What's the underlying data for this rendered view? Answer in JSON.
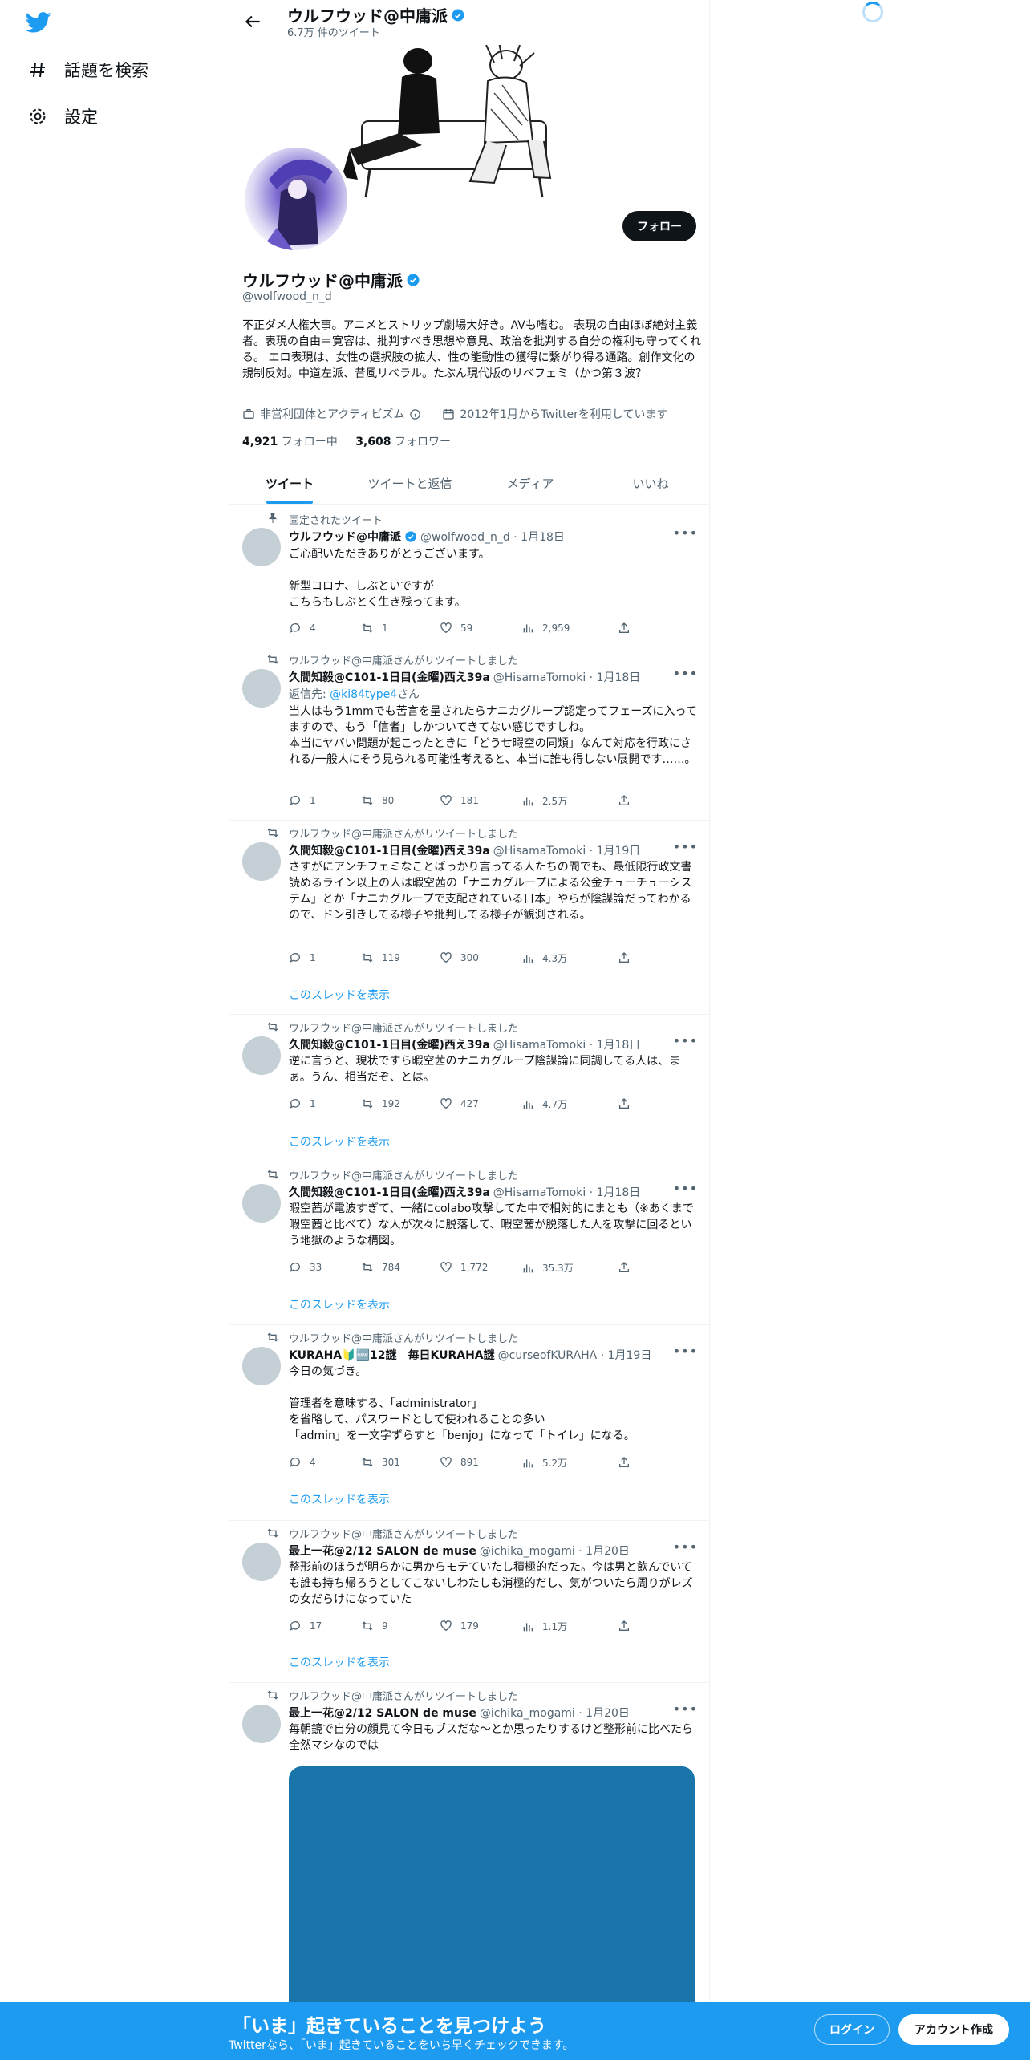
{
  "nav": {
    "explore_label": "話題を検索",
    "settings_label": "設定"
  },
  "header": {
    "name": "ウルフウッド@中庸派",
    "tweet_count": "6.7万 件のツイート"
  },
  "profile": {
    "follow_label": "フォロー",
    "name": "ウルフウッド@中庸派",
    "handle": "@wolfwood_n_d",
    "bio": "不正ダメ人権大事。アニメとストリップ劇場大好き。AVも嗜む。 表現の自由ほぼ絶対主義者。表現の自由＝寛容は、批判すべき思想や意見、政治を批判する自分の権利も守ってくれる。 エロ表現は、女性の選択肢の拡大、性の能動性の獲得に繋がり得る通路。創作文化の規制反対。中道左派、昔風リベラル。たぶん現代版のリベフェミ（かつ第３波？",
    "category": "非営利団体とアクティビズム",
    "joined": "2012年1月からTwitterを利用しています",
    "following_count": "4,921",
    "following_label": "フォロー中",
    "followers_count": "3,608",
    "followers_label": "フォロワー"
  },
  "tabs": [
    "ツイート",
    "ツイートと返信",
    "メディア",
    "いいね"
  ],
  "tweets": [
    {
      "social": "固定されたツイート",
      "name": "ウルフウッド@中庸派",
      "handle": "@wolfwood_n_d · 1月18日",
      "text": "ご心配いただきありがとうございます。\n\n新型コロナ、しぶといですが\nこちらもしぶとく生き残ってます。",
      "replies": "4",
      "retweets": "1",
      "likes": "59",
      "views": "2,959"
    },
    {
      "social": "ウルフウッド@中庸派さんがリツイートしました",
      "name": "久間知毅@C101-1日目(金曜)西え39a",
      "handle": "@HisamaTomoki · 1月18日",
      "reply_prefix": "返信先: ",
      "reply_to": "@ki84type4",
      "reply_suffix": "さん",
      "text": "当人はもう1mmでも苦言を呈されたらナニカグループ認定ってフェーズに入ってますので、もう「信者」しかついてきてない感じですしね。\n本当にヤバい問題が起こったときに「どうせ暇空の同類」なんて対応を行政にされる/一般人にそう見られる可能性考えると、本当に誰も得しない展開です……。",
      "replies": "1",
      "retweets": "80",
      "likes": "181",
      "views": "2.5万"
    },
    {
      "social": "ウルフウッド@中庸派さんがリツイートしました",
      "name": "久間知毅@C101-1日目(金曜)西え39a",
      "handle": "@HisamaTomoki · 1月19日",
      "text": "さすがにアンチフェミなことばっかり言ってる人たちの間でも、最低限行政文書読めるライン以上の人は暇空茜の「ナニカグループによる公金チューチューシステム」とか「ナニカグループで支配されている日本」やらが陰謀論だってわかるので、ドン引きしてる様子や批判してる様子が観測される。",
      "replies": "1",
      "retweets": "119",
      "likes": "300",
      "views": "4.3万",
      "thread": "このスレッドを表示"
    },
    {
      "social": "ウルフウッド@中庸派さんがリツイートしました",
      "name": "久間知毅@C101-1日目(金曜)西え39a",
      "handle": "@HisamaTomoki · 1月18日",
      "text": "逆に言うと、現状ですら暇空茜のナニカグループ陰謀論に同調してる人は、まぁ。うん、相当だぞ、とは。",
      "replies": "1",
      "retweets": "192",
      "likes": "427",
      "views": "4.7万",
      "thread": "このスレッドを表示"
    },
    {
      "social": "ウルフウッド@中庸派さんがリツイートしました",
      "name": "久間知毅@C101-1日目(金曜)西え39a",
      "handle": "@HisamaTomoki · 1月18日",
      "text": "暇空茜が電波すぎて、一緒にcolabo攻撃してた中で相対的にまとも（※あくまで暇空茜と比べて）な人が次々に脱落して、暇空茜が脱落した人を攻撃に回るという地獄のような構図。",
      "replies": "33",
      "retweets": "784",
      "likes": "1,772",
      "views": "35.3万",
      "thread": "このスレッドを表示"
    },
    {
      "social": "ウルフウッド@中庸派さんがリツイートしました",
      "name": "KURAHA🔰🆕12謎　毎日KURAHA謎",
      "handle": "@curseofKURAHA · 1月19日",
      "text": "今日の気づき。\n\n管理者を意味する、「administrator」\nを省略して、パスワードとして使われることの多い\n「admin」を一文字ずらすと「benjo」になって「トイレ」になる。",
      "replies": "4",
      "retweets": "301",
      "likes": "891",
      "views": "5.2万",
      "thread": "このスレッドを表示"
    },
    {
      "social": "ウルフウッド@中庸派さんがリツイートしました",
      "name": "最上一花@2/12 SALON de muse",
      "handle": "@ichika_mogami · 1月20日",
      "text": "整形前のほうが明らかに男からモテていたし積極的だった。今は男と飲んでいても誰も持ち帰ろうとしてこないしわたしも消極的だし、気がついたら周りがレズの女だらけになっていた",
      "replies": "17",
      "retweets": "9",
      "likes": "179",
      "views": "1.1万",
      "thread": "このスレッドを表示"
    },
    {
      "social": "ウルフウッド@中庸派さんがリツイートしました",
      "name": "最上一花@2/12 SALON de muse",
      "handle": "@ichika_mogami · 1月20日",
      "text": "毎朝鏡で自分の顔見て今日もブスだな〜とか思ったりするけど整形前に比べたら全然マシなのでは"
    }
  ],
  "bottom_bar": {
    "title": "「いま」起きていることを見つけよう",
    "subtitle": "Twitterなら、「いま」起きていることをいち早くチェックできます。",
    "login_label": "ログイン",
    "signup_label": "アカウント作成"
  },
  "colors": {
    "accent": "#1d9bf0",
    "text": "#0f1419",
    "muted": "#536471"
  },
  "icons": [
    "twitter-logo-icon",
    "hashtag-icon",
    "gear-icon",
    "back-arrow-icon",
    "verified-badge-icon",
    "briefcase-icon",
    "calendar-icon",
    "pin-icon",
    "retweet-icon",
    "reply-icon",
    "like-icon",
    "views-icon",
    "share-icon",
    "more-icon"
  ]
}
